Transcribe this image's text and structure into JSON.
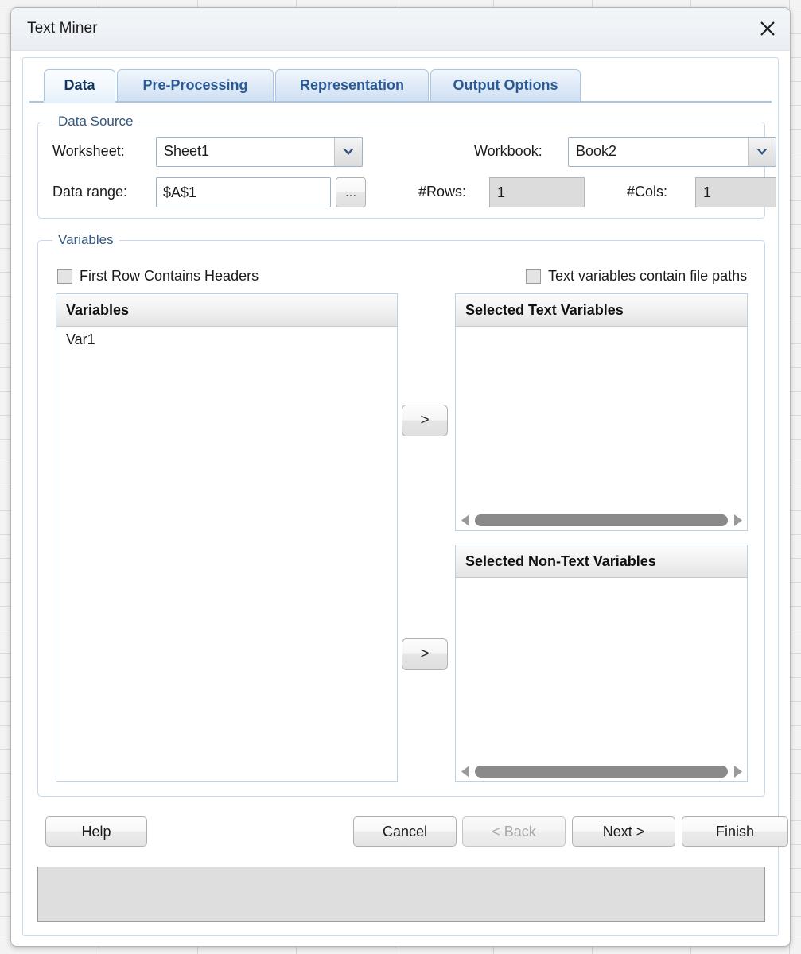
{
  "window": {
    "title": "Text Miner",
    "close_icon": "close-icon"
  },
  "tabs": [
    {
      "label": "Data",
      "active": true
    },
    {
      "label": "Pre-Processing",
      "active": false
    },
    {
      "label": "Representation",
      "active": false
    },
    {
      "label": "Output Options",
      "active": false
    }
  ],
  "data_source": {
    "group_title": "Data Source",
    "worksheet_label": "Worksheet:",
    "worksheet_value": "Sheet1",
    "workbook_label": "Workbook:",
    "workbook_value": "Book2",
    "data_range_label": "Data range:",
    "data_range_value": "$A$1",
    "browse_label": "...",
    "rows_label": "#Rows:",
    "rows_value": "1",
    "cols_label": "#Cols:",
    "cols_value": "1"
  },
  "variables": {
    "group_title": "Variables",
    "first_row_headers_label": "First Row Contains Headers",
    "first_row_headers_checked": false,
    "file_paths_label": "Text variables contain file paths",
    "file_paths_checked": false,
    "variables_list": {
      "header": "Variables",
      "items": [
        "Var1"
      ]
    },
    "selected_text": {
      "header": "Selected Text Variables",
      "items": []
    },
    "selected_non_text": {
      "header": "Selected Non-Text Variables",
      "items": []
    },
    "transfer_text_label": ">",
    "transfer_non_text_label": ">"
  },
  "footer": {
    "help_label": "Help",
    "cancel_label": "Cancel",
    "back_label": "< Back",
    "back_disabled": true,
    "next_label": "Next >",
    "finish_label": "Finish"
  },
  "status": {
    "text": ""
  },
  "colors": {
    "accent_blue": "#2a5a96",
    "group_title": "#33577f",
    "tab_border": "#a8c6e3",
    "scrollbar_thumb": "#8a8a8a",
    "readonly_bg": "#dcdcdc",
    "status_bg": "#dedede"
  }
}
